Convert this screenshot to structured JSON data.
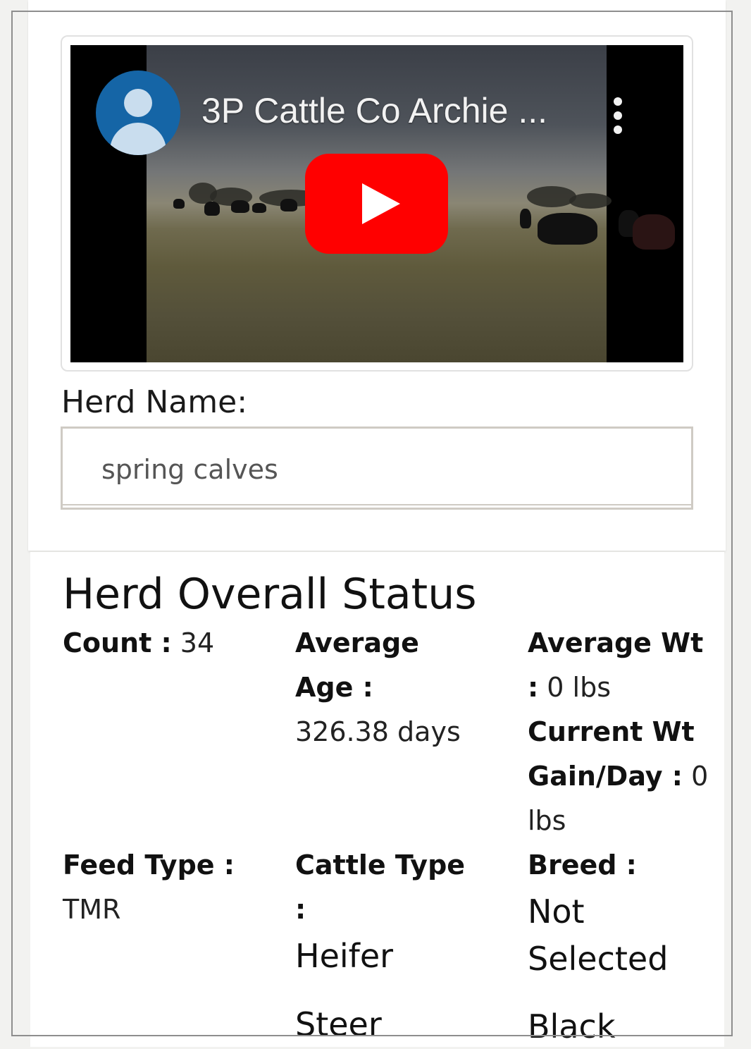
{
  "video": {
    "title": "3P Cattle Co Archie ...",
    "play_color": "#ff0000"
  },
  "herd_name": {
    "label": "Herd Name:",
    "value": "spring calves"
  },
  "status": {
    "title": "Herd Overall Status",
    "count_label": "Count :",
    "count_value": "34",
    "avg_age_label_1": "Average",
    "avg_age_label_2": "Age :",
    "avg_age_value": "326.38 days",
    "avg_wt_label_1": "Average Wt",
    "avg_wt_label_2": ":",
    "avg_wt_value": "0 lbs",
    "gain_label_1": "Current Wt",
    "gain_label_2": "Gain/Day :",
    "gain_value_1": "0",
    "gain_value_2": "lbs",
    "feed_label": "Feed Type :",
    "feed_value": "TMR",
    "cattle_label_1": "Cattle Type",
    "cattle_label_2": ":",
    "cattle_values": [
      "Heifer",
      "Steer"
    ],
    "breed_label": "Breed :",
    "breed_values": [
      "Not",
      "Selected",
      "Black"
    ]
  }
}
